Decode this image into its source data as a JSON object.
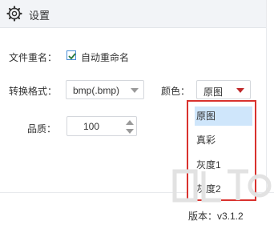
{
  "header": {
    "title": "设置",
    "icon": "gear-icon"
  },
  "form": {
    "rename_label": "文件重名：",
    "auto_rename_label": "自动重命名",
    "auto_rename_checked": true,
    "format_label": "转换格式：",
    "format_value": "bmp(.bmp)",
    "color_label": "颜色：",
    "color_value": "原图",
    "quality_label": "品质：",
    "quality_value": "100"
  },
  "color_dropdown": {
    "options": [
      "原图",
      "真彩",
      "灰度1",
      "灰度2"
    ],
    "selected_index": 0
  },
  "footer": {
    "version": "版本：v3.1.2"
  },
  "colors": {
    "accent": "#4a8fd6",
    "highlight_border": "#d9322e",
    "selected_bg": "#cfe6fb",
    "caret_red": "#c0292b"
  }
}
